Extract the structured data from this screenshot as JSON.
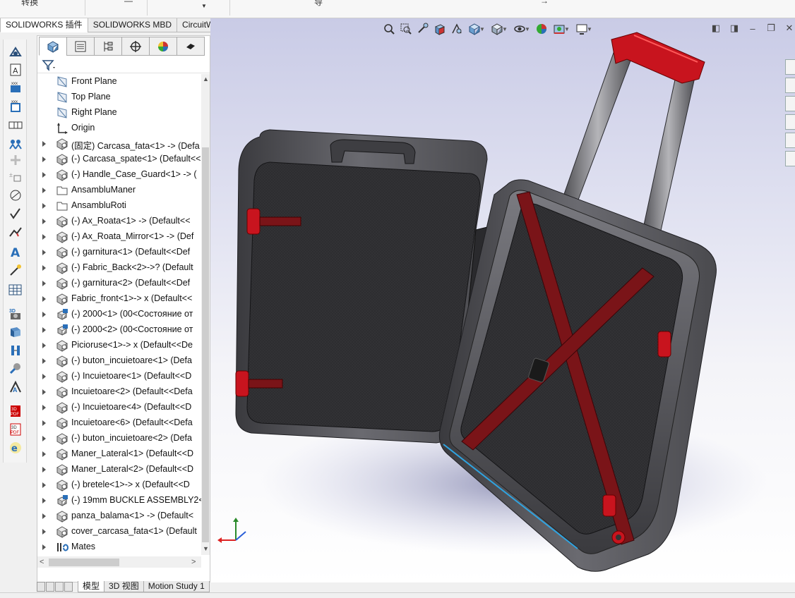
{
  "ribbon": {
    "partial_labels": [
      "转换",
      "导",
      "→"
    ]
  },
  "command_tabs": [
    {
      "label": "SOLIDWORKS 插件",
      "active": true
    },
    {
      "label": "SOLIDWORKS MBD",
      "active": false
    },
    {
      "label": "CircuitWorks",
      "active": false
    }
  ],
  "feature_tree": {
    "nodes": [
      {
        "label": "Front Plane",
        "icon": "plane-icon",
        "expandable": false
      },
      {
        "label": "Top Plane",
        "icon": "plane-icon",
        "expandable": false
      },
      {
        "label": "Right Plane",
        "icon": "plane-icon",
        "expandable": false
      },
      {
        "label": "Origin",
        "icon": "origin-icon",
        "expandable": false
      },
      {
        "label": "(固定) Carcasa_fata<1> -> (Defa",
        "icon": "part-icon",
        "expandable": true
      },
      {
        "label": "(-) Carcasa_spate<1> (Default<<",
        "icon": "part-icon",
        "expandable": true
      },
      {
        "label": "(-) Handle_Case_Guard<1> -> (",
        "icon": "part-icon",
        "expandable": true
      },
      {
        "label": "AnsambluManer",
        "icon": "folder-icon",
        "expandable": true
      },
      {
        "label": "AnsambluRoti",
        "icon": "folder-icon",
        "expandable": true
      },
      {
        "label": "(-) Ax_Roata<1> -> (Default<<",
        "icon": "part-icon",
        "expandable": true
      },
      {
        "label": "(-) Ax_Roata_Mirror<1> -> (Def",
        "icon": "part-icon",
        "expandable": true
      },
      {
        "label": "(-) garnitura<1> (Default<<Def",
        "icon": "part-icon",
        "expandable": true
      },
      {
        "label": "(-) Fabric_Back<2>->? (Default",
        "icon": "part-icon",
        "expandable": true
      },
      {
        "label": "(-) garnitura<2> (Default<<Def",
        "icon": "part-icon",
        "expandable": true
      },
      {
        "label": "Fabric_front<1>-> x (Default<<",
        "icon": "part-icon",
        "expandable": true
      },
      {
        "label": "(-) 2000<1> (00<Состояние от",
        "icon": "assembly-icon",
        "expandable": true
      },
      {
        "label": "(-) 2000<2> (00<Состояние от",
        "icon": "assembly-icon",
        "expandable": true
      },
      {
        "label": "Picioruse<1>-> x (Default<<De",
        "icon": "part-icon",
        "expandable": true
      },
      {
        "label": "(-) buton_incuietoare<1> (Defa",
        "icon": "part-icon",
        "expandable": true
      },
      {
        "label": "(-) Incuietoare<1> (Default<<D",
        "icon": "part-icon",
        "expandable": true
      },
      {
        "label": "Incuietoare<2> (Default<<Defa",
        "icon": "part-icon",
        "expandable": true
      },
      {
        "label": "(-) Incuietoare<4> (Default<<D",
        "icon": "part-icon",
        "expandable": true
      },
      {
        "label": "Incuietoare<6> (Default<<Defa",
        "icon": "part-icon",
        "expandable": true
      },
      {
        "label": "(-) buton_incuietoare<2> (Defa",
        "icon": "part-icon",
        "expandable": true
      },
      {
        "label": "Maner_Lateral<1> (Default<<D",
        "icon": "part-icon",
        "expandable": true
      },
      {
        "label": "Maner_Lateral<2> (Default<<D",
        "icon": "part-icon",
        "expandable": true
      },
      {
        "label": "(-) bretele<1>-> x (Default<<D",
        "icon": "part-icon",
        "expandable": true
      },
      {
        "label": "(-) 19mm BUCKLE ASSEMBLY2<",
        "icon": "assembly-icon",
        "expandable": true
      },
      {
        "label": "panza_balama<1> -> (Default<",
        "icon": "part-icon",
        "expandable": true
      },
      {
        "label": "cover_carcasa_fata<1> (Default",
        "icon": "part-icon",
        "expandable": true
      },
      {
        "label": "Mates",
        "icon": "mates-icon",
        "expandable": true
      }
    ]
  },
  "bottom_tabs": [
    {
      "label": "模型",
      "active": true
    },
    {
      "label": "3D 视图",
      "active": false
    },
    {
      "label": "Motion Study 1",
      "active": false
    }
  ],
  "colors": {
    "accent_red": "#c8141e",
    "case_gray": "#5a5a5e",
    "lining": "#2e2e30",
    "strap": "#7a1418"
  }
}
